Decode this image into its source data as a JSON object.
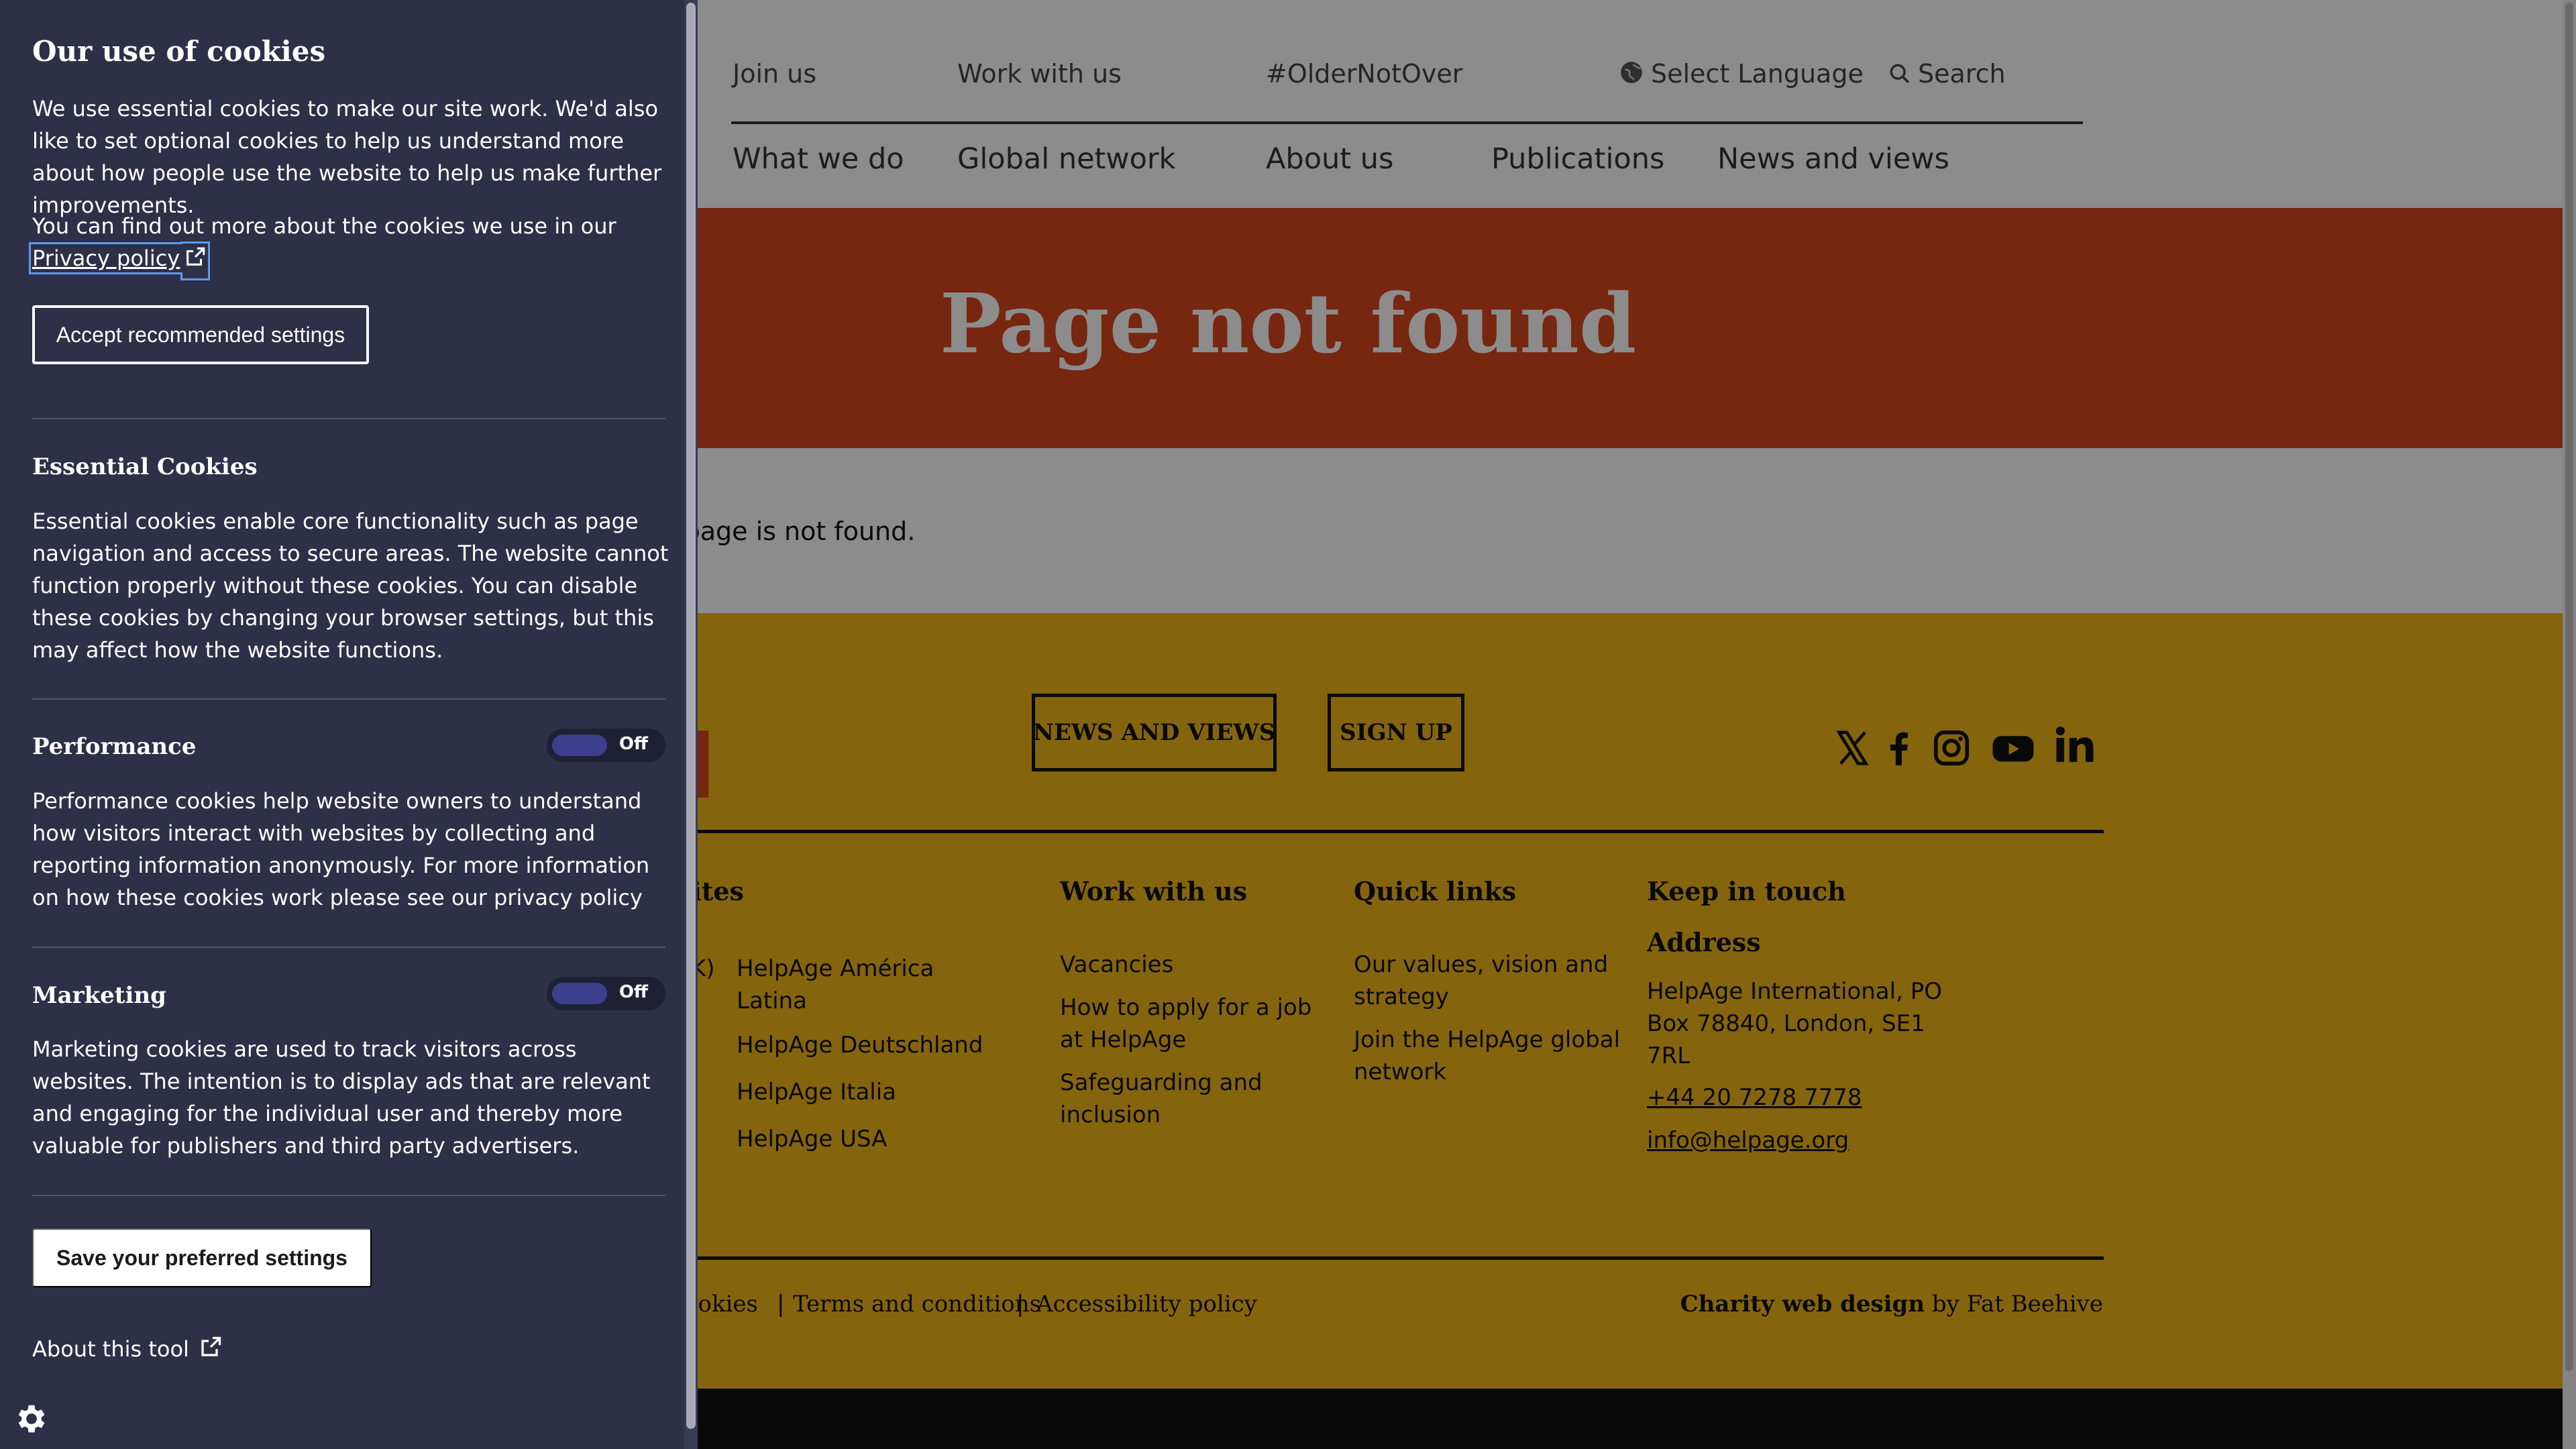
{
  "nav": {
    "utility": [
      "Join us",
      "Work with us",
      "#OlderNotOver"
    ],
    "select_language": "Select Language",
    "search": "Search",
    "main": [
      "What we do",
      "Global network",
      "About us",
      "Publications",
      "News and views"
    ]
  },
  "banner": {
    "title": "Page not found"
  },
  "content": {
    "message": "ed page is not found."
  },
  "footer": {
    "buttons": [
      "NEWS AND VIEWS",
      "SIGN UP"
    ],
    "social_icons": [
      "x-icon",
      "facebook-icon",
      "instagram-icon",
      "youtube-icon",
      "linkedin-icon"
    ],
    "sites": {
      "heading": "sites",
      "prefix": "K)",
      "links": [
        "HelpAge América Latina",
        "HelpAge Deutschland",
        "HelpAge Italia",
        "HelpAge USA"
      ]
    },
    "work": {
      "heading": "Work with us",
      "links": [
        "Vacancies",
        "How to apply for a job at HelpAge",
        "Safeguarding and inclusion"
      ]
    },
    "quick": {
      "heading": "Quick links",
      "links": [
        "Our values, vision and strategy",
        "Join the HelpAge global network"
      ]
    },
    "keep": {
      "heading": "Keep in touch",
      "address_heading": "Address",
      "address": "HelpAge International, PO Box 78840, London, SE1 7RL",
      "phone": "+44 20 7278 7778",
      "email": "info@helpage.org"
    },
    "legal": [
      "ookies",
      "Terms and conditions",
      "Accessibility policy"
    ],
    "credit_bold": "Charity web design",
    "credit_rest": " by Fat Beehive"
  },
  "cookie": {
    "title": "Our use of cookies",
    "intro": "We use essential cookies to make our site work. We'd also like to set optional cookies to help us understand more about how people use the website to help us make further improvements.",
    "find_more": "You can find out more about the cookies we use in our ",
    "privacy_link": "Privacy policy",
    "accept_button": "Accept recommended settings",
    "essential_heading": "Essential Cookies",
    "essential_text": "Essential cookies enable core functionality such as page navigation and access to secure areas. The website cannot function properly without these cookies. You can disable these cookies by changing your browser settings, but this may affect how the website functions.",
    "performance_heading": "Performance",
    "performance_state": "Off",
    "performance_text": "Performance cookies help website owners to understand how visitors interact with websites by collecting and reporting information anonymously. For more information on how these cookies work please see our privacy policy",
    "marketing_heading": "Marketing",
    "marketing_state": "Off",
    "marketing_text": "Marketing cookies are used to track visitors across websites. The intention is to display ads that are relevant and engaging for the individual user and thereby more valuable for publishers and third party advertisers.",
    "save_button": "Save your preferred settings",
    "about_tool": "About this tool"
  },
  "colors": {
    "banner": "#d9451c",
    "footer": "#f2b71b",
    "cookie_panel": "#2e3048",
    "toggle_knob": "#3c3f8c"
  }
}
